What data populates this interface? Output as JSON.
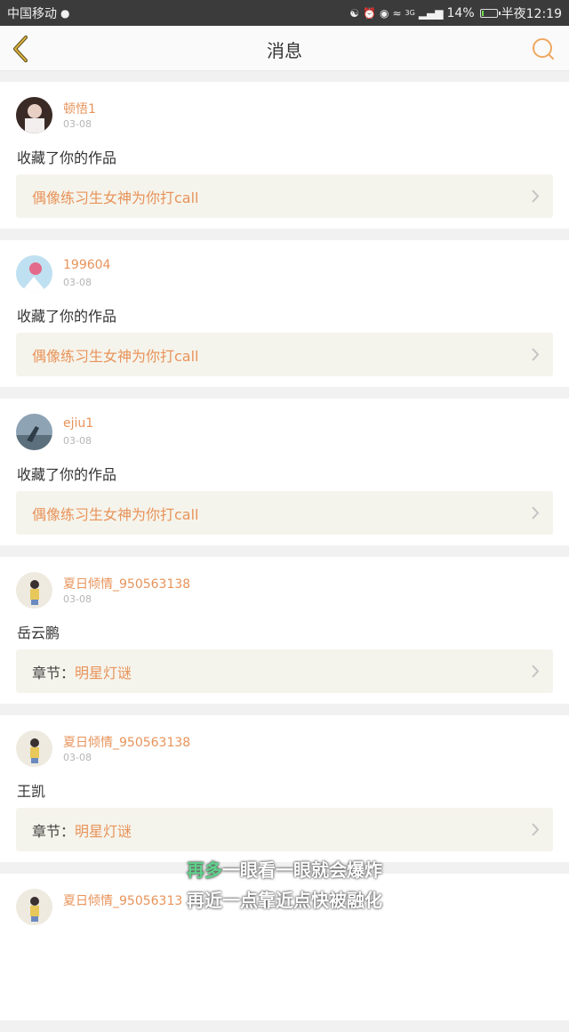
{
  "status_bar": {
    "carrier": "中国移动",
    "network": "3G",
    "battery": "14%",
    "battery_level": 0.14,
    "time": "半夜12:19"
  },
  "header": {
    "title": "消息",
    "back_icon": "back-chevron-icon",
    "search_icon": "search-icon"
  },
  "messages": [
    {
      "username": "顿悟1",
      "date": "03-08",
      "content": "收藏了你的作品",
      "link_prefix": "",
      "link_title": "偶像练习生女神为你打call"
    },
    {
      "username": "199604",
      "date": "03-08",
      "content": "收藏了你的作品",
      "link_prefix": "",
      "link_title": "偶像练习生女神为你打call"
    },
    {
      "username": "ejiu1",
      "date": "03-08",
      "content": "收藏了你的作品",
      "link_prefix": "",
      "link_title": "偶像练习生女神为你打call"
    },
    {
      "username": "夏日倾情_950563138",
      "date": "03-08",
      "content": "岳云鹏",
      "link_prefix": "章节：",
      "link_title": "明星灯谜"
    },
    {
      "username": "夏日倾情_950563138",
      "date": "03-08",
      "content": "王凯",
      "link_prefix": "章节：",
      "link_title": "明星灯谜"
    },
    {
      "username": "夏日倾情_95056313",
      "date": "",
      "content": "",
      "link_prefix": "",
      "link_title": ""
    }
  ],
  "overlay_caption": {
    "line1_highlight": "再多",
    "line1_rest": "一眼看一眼就会爆炸",
    "line2": "再近一点靠近点快被融化"
  },
  "colors": {
    "accent": "#e8935a",
    "status_bar": "#3b3b3b",
    "link_box": "#f5f4ec",
    "caption_highlight": "#5fd18a"
  }
}
